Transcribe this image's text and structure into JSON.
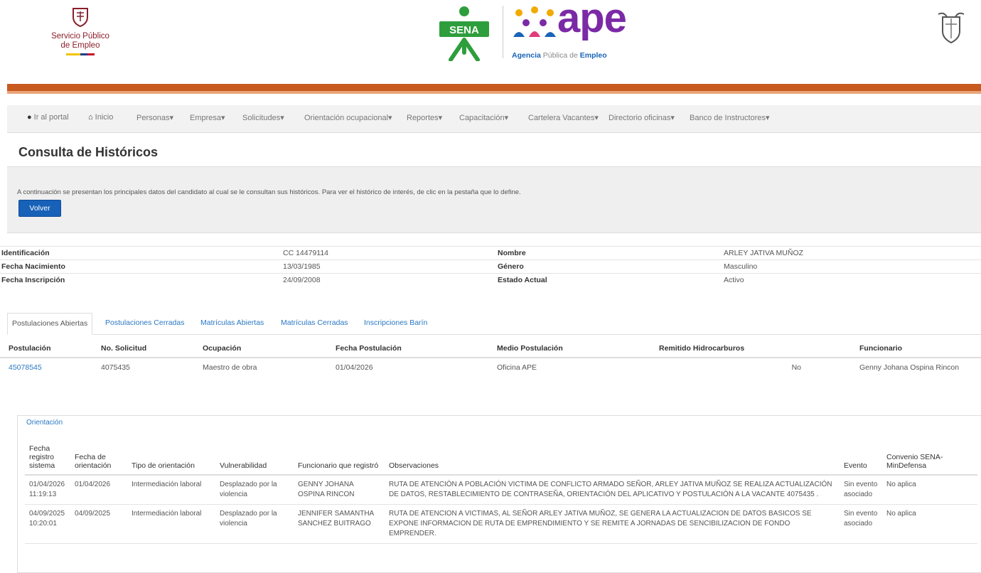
{
  "header": {
    "spe_logo": {
      "line1": "Servicio Público",
      "line2": "de Empleo"
    },
    "sena_logo": "SENA",
    "ape_logo": {
      "mark": "ape",
      "tag_prefix": "Agencia",
      "tag_mid": "Pública de",
      "tag_suffix": "Empleo"
    }
  },
  "nav": {
    "items": [
      {
        "label": "Ir al portal",
        "icon": "circle-icon"
      },
      {
        "label": "Inicio",
        "icon": "home-icon"
      },
      {
        "label": "Personas"
      },
      {
        "label": "Empresa"
      },
      {
        "label": "Solicitudes"
      },
      {
        "label": "Orientación ocupacional"
      },
      {
        "label": "Reportes"
      },
      {
        "label": "Capacitación"
      },
      {
        "label": "Cartelera Vacantes"
      },
      {
        "label": "Directorio oficinas"
      },
      {
        "label": "Banco de Instructores"
      }
    ]
  },
  "page": {
    "title": "Consulta de Históricos",
    "intro": "A continuación se presentan los principales datos del candidato al cual se le consultan sus históricos. Para ver el histórico de interés, de clic en la pestaña que lo define.",
    "back_button": "Volver"
  },
  "candidate": {
    "identificacion_label": "Identificación",
    "identificacion": "CC 14479114",
    "nombre_label": "Nombre",
    "nombre": "ARLEY JATIVA MUÑOZ",
    "nacimiento_label": "Fecha Nacimiento",
    "nacimiento": "13/03/1985",
    "genero_label": "Género",
    "genero": "Masculino",
    "inscripcion_label": "Fecha Inscripción",
    "inscripcion": "24/09/2008",
    "estado_label": "Estado Actual",
    "estado": "Activo"
  },
  "tabs": [
    {
      "label": "Postulaciones Abiertas",
      "active": true
    },
    {
      "label": "Postulaciones Cerradas"
    },
    {
      "label": "Matrículas Abiertas"
    },
    {
      "label": "Matrículas Cerradas"
    },
    {
      "label": "Inscripciones Barín"
    }
  ],
  "postulaciones": {
    "headers": [
      "Postulación",
      "No. Solicitud",
      "Ocupación",
      "Fecha Postulación",
      "Medio Postulación",
      "Remitido Hidrocarburos",
      "Funcionario"
    ],
    "rows": [
      [
        "45078545",
        "4075435",
        "Maestro de obra",
        "01/04/2026",
        "Oficina APE",
        "No",
        "Genny Johana Ospina Rincon"
      ]
    ]
  },
  "orientacion": {
    "tab_label": "Orientación",
    "headers": [
      "Fecha registro sistema",
      "Fecha de orientación",
      "Tipo de orientación",
      "Vulnerabilidad",
      "Funcionario que registró",
      "Observaciones",
      "Evento",
      "Convenio SENA-MinDefensa"
    ],
    "rows": [
      [
        "01/04/2026 11:19:13",
        "01/04/2026",
        "Intermediación laboral",
        "Desplazado por la violencia",
        "GENNY JOHANA OSPINA RINCON",
        "RUTA DE ATENCIÓN A POBLACIÓN VICTIMA DE CONFLICTO ARMADO SEÑOR, ARLEY JATIVA MUÑOZ SE REALIZA ACTUALIZACIÓN DE DATOS, RESTABLECIMIENTO DE CONTRASEÑA, ORIENTACIÓN DEL APLICATIVO Y POSTULACIÓN A LA VACANTE 4075435 .",
        "Sin evento asociado",
        "No aplica"
      ],
      [
        "04/09/2025 10:20:01",
        "04/09/2025",
        "Intermediación laboral",
        "Desplazado por la violencia",
        "JENNIFER SAMANTHA SANCHEZ BUITRAGO",
        "RUTA DE ATENCION A VICTIMAS, AL SEÑOR ARLEY JATIVA MUÑOZ, SE GENERA LA ACTUALIZACION DE DATOS BASICOS SE EXPONE INFORMACION DE RUTA DE EMPRENDIMIENTO Y SE REMITE A JORNADAS DE SENCIBILIZACION DE FONDO EMPRENDER.",
        "Sin evento asociado",
        "No aplica"
      ]
    ]
  },
  "colors": {
    "accent_orange": "#c8591f",
    "link_blue": "#2a78c3",
    "button_blue": "#1761b8",
    "ape_purple": "#7b2aa6",
    "sena_green": "#2e9e3c"
  }
}
